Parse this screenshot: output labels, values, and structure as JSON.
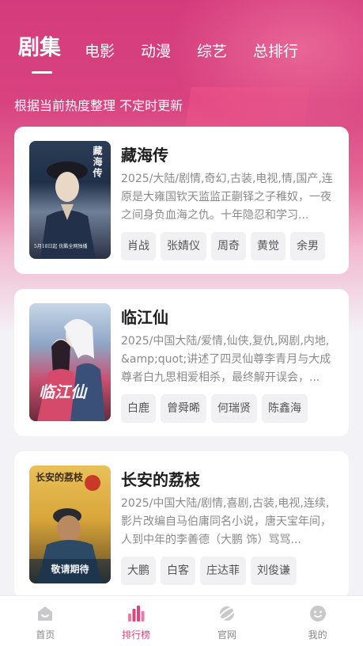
{
  "colors": {
    "accent": "#e0457f",
    "header": "#d43b7c",
    "card": "#ffffff",
    "bg": "#f3f2f6"
  },
  "tabs": [
    {
      "label": "剧集",
      "active": true
    },
    {
      "label": "电影",
      "active": false
    },
    {
      "label": "动漫",
      "active": false
    },
    {
      "label": "综艺",
      "active": false
    },
    {
      "label": "总排行",
      "active": false
    }
  ],
  "subtitle": "根据当前热度整理 不定时更新",
  "shows": [
    {
      "title": "藏海传",
      "meta": "2025/大陆/剧情,奇幻,古装,电视,情,国产,连",
      "desc": "原是大雍国钦天监监正蒯铎之子稚奴，一夜之间身负血海之仇。十年隐忍和学习...",
      "actors": [
        "肖战",
        "张婧仪",
        "周奇",
        "黄觉",
        "余男"
      ],
      "poster_text": "藏海传",
      "poster_note": "5月18日起 优酷全网独播"
    },
    {
      "title": "临江仙",
      "meta": "2025/中国大陆/爱情,仙侠,复仇,网剧,内地,",
      "desc": "&amp;quot;讲述了四灵仙尊李青月与大成尊者白九思相爱相杀，最终解开误会，...",
      "actors": [
        "白鹿",
        "曾舜晞",
        "何瑞贤",
        "陈鑫海"
      ],
      "poster_text": "临江仙",
      "poster_note": ""
    },
    {
      "title": "长安的荔枝",
      "meta": "2025/中国大陆/剧情,喜剧,古装,电视,连续,",
      "desc": "影片改编自马伯庸同名小说，唐天宝年间，人到中年的李善德（大鹏 饰）骂骂...",
      "actors": [
        "大鹏",
        "白客",
        "庄达菲",
        "刘俊谦"
      ],
      "poster_text": "长安的荔枝",
      "poster_note": "敬请期待"
    }
  ],
  "nav": [
    {
      "label": "首页",
      "icon": "home-icon",
      "active": false
    },
    {
      "label": "排行榜",
      "icon": "ranking-icon",
      "active": true
    },
    {
      "label": "官网",
      "icon": "planet-icon",
      "active": false
    },
    {
      "label": "我的",
      "icon": "smile-face-icon",
      "active": false
    }
  ]
}
